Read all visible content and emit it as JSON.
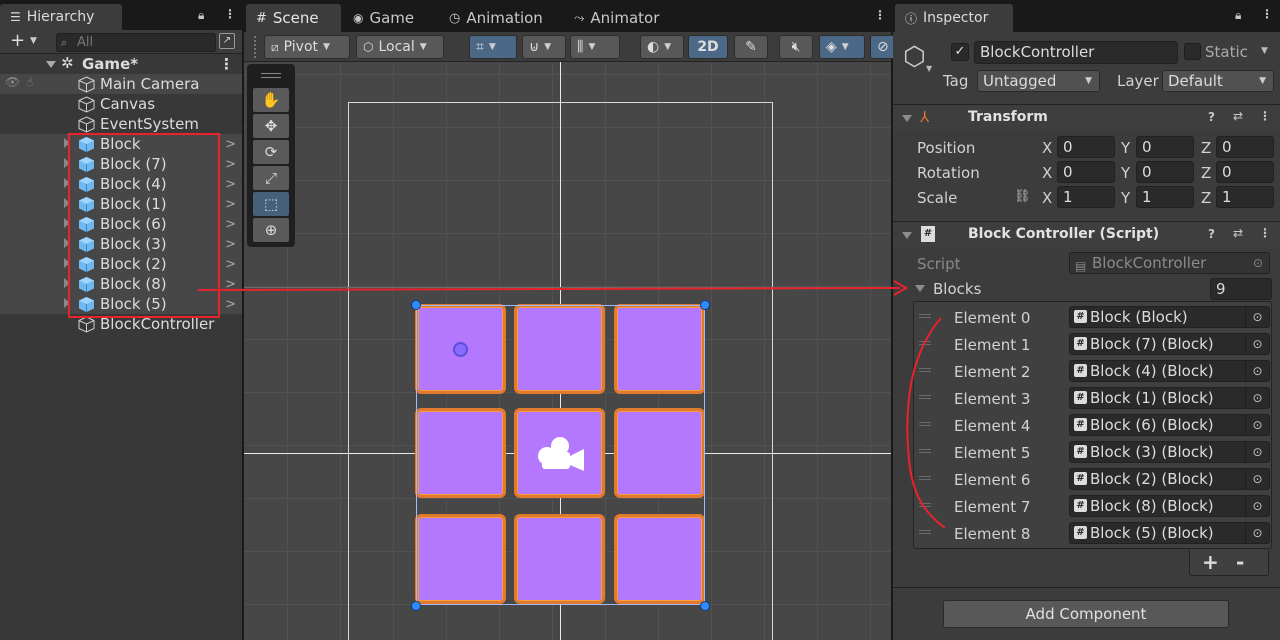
{
  "hierarchy": {
    "tab_label": "Hierarchy",
    "search_placeholder": "All",
    "scene_name": "Game*",
    "items": [
      {
        "label": "Main Camera"
      },
      {
        "label": "Canvas"
      },
      {
        "label": "EventSystem"
      },
      {
        "label": "Block"
      },
      {
        "label": "Block (7)"
      },
      {
        "label": "Block (4)"
      },
      {
        "label": "Block (1)"
      },
      {
        "label": "Block (6)"
      },
      {
        "label": "Block (3)"
      },
      {
        "label": "Block (2)"
      },
      {
        "label": "Block (8)"
      },
      {
        "label": "Block (5)"
      },
      {
        "label": "BlockController"
      }
    ]
  },
  "scene": {
    "tabs": [
      {
        "label": "Scene"
      },
      {
        "label": "Game"
      },
      {
        "label": "Animation"
      },
      {
        "label": "Animator"
      }
    ],
    "toolbar": {
      "pivot_label": "Pivot",
      "local_label": "Local",
      "mode_2d_label": "2D"
    }
  },
  "inspector": {
    "tab_label": "Inspector",
    "object_name": "BlockController",
    "static_label": "Static",
    "tag_label": "Tag",
    "tag_value": "Untagged",
    "layer_label": "Layer",
    "layer_value": "Default",
    "transform": {
      "title": "Transform",
      "position_label": "Position",
      "rotation_label": "Rotation",
      "scale_label": "Scale",
      "x_label": "X",
      "y_label": "Y",
      "z_label": "Z",
      "position": {
        "x": "0",
        "y": "0",
        "z": "0"
      },
      "rotation": {
        "x": "0",
        "y": "0",
        "z": "0"
      },
      "scale": {
        "x": "1",
        "y": "1",
        "z": "1"
      }
    },
    "script_component": {
      "title": "Block Controller (Script)",
      "script_label": "Script",
      "script_value": "BlockController",
      "blocks_label": "Blocks",
      "blocks_count": "9",
      "elements": [
        {
          "label": "Element 0",
          "value": "Block (Block)"
        },
        {
          "label": "Element 1",
          "value": "Block (7) (Block)"
        },
        {
          "label": "Element 2",
          "value": "Block (4) (Block)"
        },
        {
          "label": "Element 3",
          "value": "Block (1) (Block)"
        },
        {
          "label": "Element 4",
          "value": "Block (6) (Block)"
        },
        {
          "label": "Element 5",
          "value": "Block (3) (Block)"
        },
        {
          "label": "Element 6",
          "value": "Block (2) (Block)"
        },
        {
          "label": "Element 7",
          "value": "Block (8) (Block)"
        },
        {
          "label": "Element 8",
          "value": "Block (5) (Block)"
        }
      ],
      "add_symbol": "+",
      "remove_symbol": "-"
    },
    "add_component_label": "Add Component"
  },
  "colors": {
    "block_fill": "#b478ff",
    "block_outline": "#e07a2c",
    "annotation_red": "#e8232b",
    "selection_blue": "#2f8cff"
  }
}
